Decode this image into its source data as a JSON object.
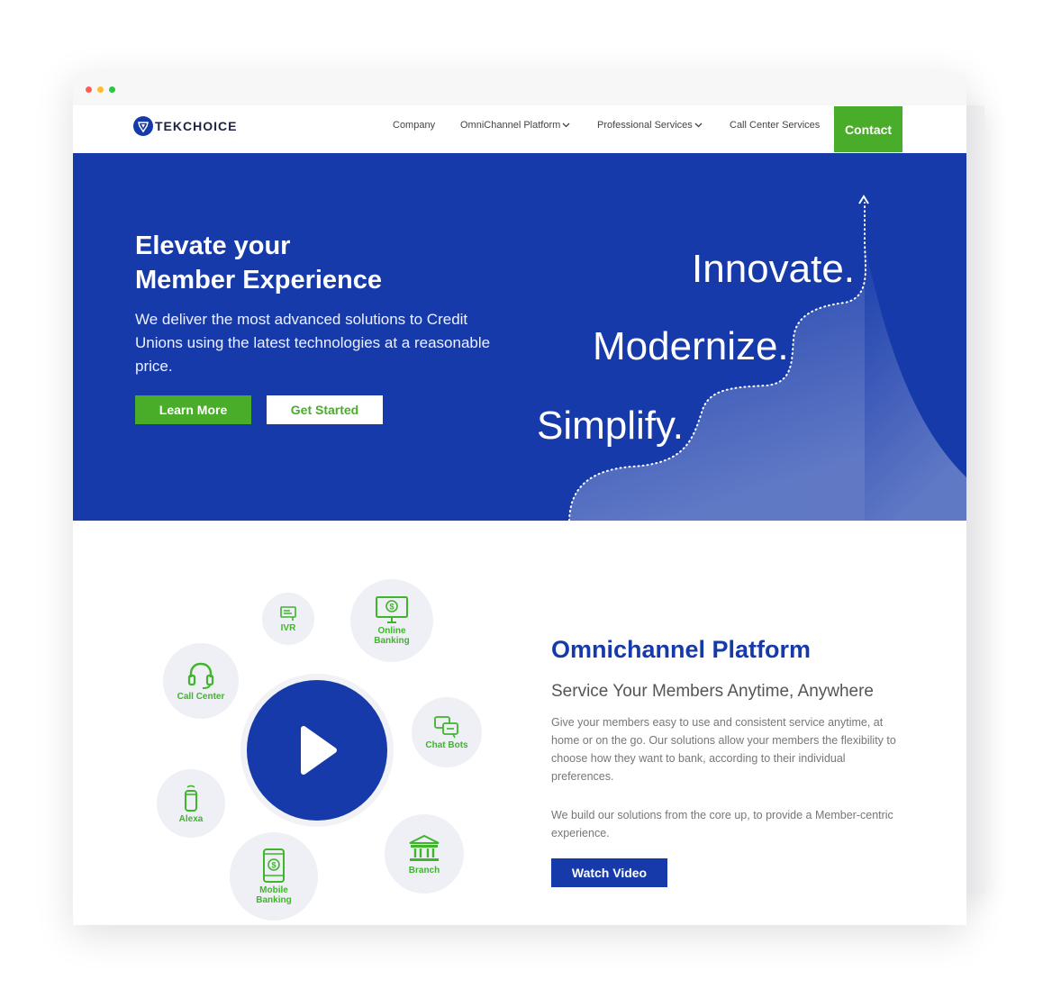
{
  "colors": {
    "brand_blue": "#163aaa",
    "brand_green": "#49ad2a",
    "icon_green": "#3fb52b",
    "dot_red": "#ff5f57",
    "dot_yellow": "#febc2e",
    "dot_green": "#28c840"
  },
  "logo": {
    "text": "TEKCHOICE",
    "icon": "tekchoice-shield-icon"
  },
  "nav": {
    "company": "Company",
    "omnichannel": "OmniChannel Platform",
    "professional": "Professional Services",
    "callcenter": "Call Center Services",
    "contact": "Contact"
  },
  "hero": {
    "title_line1": "Elevate your",
    "title_line2": "Member Experience",
    "subtitle": "We deliver the most advanced solutions to Credit Unions using the latest technologies at a reasonable price.",
    "learn_more": "Learn More",
    "get_started": "Get Started",
    "word_innovate": "Innovate.",
    "word_modernize": "Modernize.",
    "word_simplify": "Simplify."
  },
  "omni": {
    "title": "Omnichannel Platform",
    "subtitle": "Service Your Members Anytime, Anywhere",
    "paragraph1": "Give your members easy to use and consistent service anytime, at home or on the go. Our solutions allow your members the flexibility to choose how they want to bank, according to their individual preferences.",
    "paragraph2": "We build our solutions from the core up, to provide a Member-centric experience.",
    "watch_video": "Watch Video",
    "channels": {
      "ivr": "IVR",
      "online_banking": "Online Banking",
      "call_center": "Call Center",
      "chat_bots": "Chat Bots",
      "alexa": "Alexa",
      "branch": "Branch",
      "mobile_banking": "Mobile Banking"
    }
  }
}
